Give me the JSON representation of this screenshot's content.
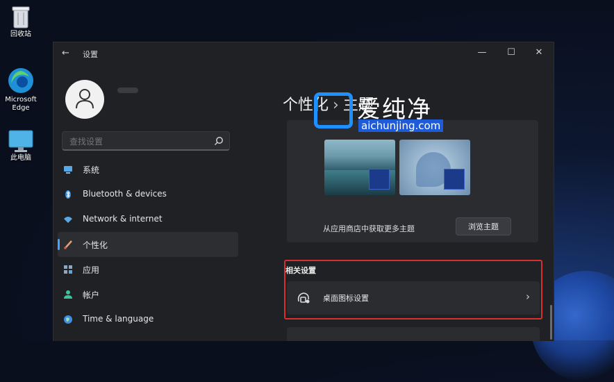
{
  "desktop": {
    "icons": [
      {
        "name": "recycle-bin",
        "label": "回收站"
      },
      {
        "name": "microsoft-edge",
        "label": "Microsoft Edge"
      },
      {
        "name": "this-pc",
        "label": "此电脑"
      }
    ]
  },
  "window": {
    "title": "设置",
    "controls": {
      "minimize": "—",
      "maximize": "☐",
      "close": "✕"
    }
  },
  "search": {
    "placeholder": "查找设置"
  },
  "nav": {
    "items": [
      {
        "label": "系统",
        "icon": "monitor-icon"
      },
      {
        "label": "Bluetooth & devices",
        "icon": "bluetooth-icon"
      },
      {
        "label": "Network & internet",
        "icon": "wifi-icon"
      },
      {
        "label": "个性化",
        "icon": "brush-icon",
        "selected": true
      },
      {
        "label": "应用",
        "icon": "apps-icon"
      },
      {
        "label": "帐户",
        "icon": "person-icon"
      },
      {
        "label": "Time & language",
        "icon": "globe-icon"
      }
    ]
  },
  "content": {
    "breadcrumb_parent": "个性化",
    "breadcrumb_sep": "›",
    "breadcrumb_current": "主题",
    "store_text": "从应用商店中获取更多主题",
    "browse_button": "浏览主题",
    "related_title": "相关设置",
    "desktop_icons_label": "桌面图标设置",
    "chevron": "›"
  },
  "watermark": {
    "cn": "爱纯净",
    "en": "aichunjing.com"
  },
  "colors": {
    "accent": "#4ea1ff",
    "highlight_border": "#d8302f",
    "watermark_blue": "#1e90ff"
  }
}
